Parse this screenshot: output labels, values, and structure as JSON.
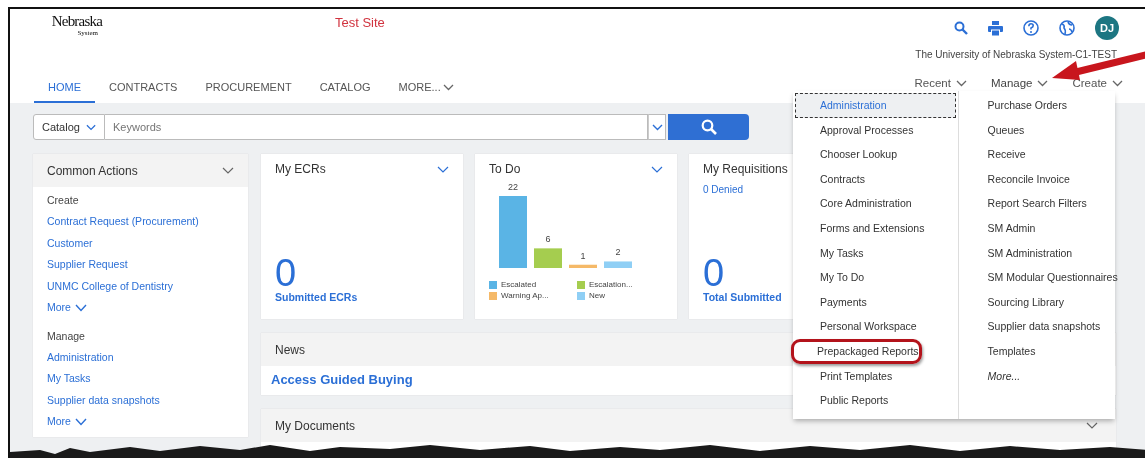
{
  "header": {
    "logo": {
      "top": "Nebraska",
      "sub": "System"
    },
    "site_label": "Test Site",
    "avatar": "DJ",
    "organization": "The University of Nebraska System-C1-TEST"
  },
  "tabs": [
    {
      "label": "HOME",
      "selected": true
    },
    {
      "label": "CONTRACTS",
      "selected": false
    },
    {
      "label": "PROCUREMENT",
      "selected": false
    },
    {
      "label": "CATALOG",
      "selected": false
    },
    {
      "label": "MORE...",
      "selected": false
    }
  ],
  "quick_menus": [
    {
      "label": "Recent",
      "expanded": false
    },
    {
      "label": "Manage",
      "expanded": true
    },
    {
      "label": "Create",
      "expanded": false
    }
  ],
  "search": {
    "scope": "Catalog",
    "placeholder": "Keywords"
  },
  "common_actions": {
    "title": "Common Actions",
    "sections": [
      {
        "heading": "Create",
        "links": [
          "Contract Request (Procurement)",
          "Customer",
          "Supplier Request",
          "UNMC College of Dentistry"
        ],
        "more": "More"
      },
      {
        "heading": "Manage",
        "links": [
          "Administration",
          "My Tasks",
          "Supplier data snapshots"
        ],
        "more": "More"
      }
    ]
  },
  "ecrs": {
    "title": "My ECRs",
    "count": "0",
    "caption": "Submitted ECRs"
  },
  "todo": {
    "title": "To Do",
    "bar_labels": [
      "22",
      "6",
      "1",
      "2"
    ],
    "legend": [
      {
        "label": "Escalated",
        "color": "#5ab4e5"
      },
      {
        "label": "Escalation...",
        "color": "#a5cd4f"
      },
      {
        "label": "Warning Ap...",
        "color": "#f5b968"
      },
      {
        "label": "New",
        "color": "#8fcff5"
      }
    ]
  },
  "requisitions": {
    "title": "My Requisitions",
    "denied": "0 Denied",
    "count": "0",
    "caption": "Total Submitted"
  },
  "news": {
    "title": "News",
    "link": "Access Guided Buying"
  },
  "documents": {
    "title": "My Documents"
  },
  "manage_menu": {
    "columns": [
      [
        {
          "label": "Administration",
          "selected": true,
          "highlighted": false
        },
        {
          "label": "Approval Processes",
          "selected": false,
          "highlighted": false
        },
        {
          "label": "Chooser Lookup",
          "selected": false,
          "highlighted": false
        },
        {
          "label": "Contracts",
          "selected": false,
          "highlighted": false
        },
        {
          "label": "Core Administration",
          "selected": false,
          "highlighted": false
        },
        {
          "label": "Forms and Extensions",
          "selected": false,
          "highlighted": false
        },
        {
          "label": "My Tasks",
          "selected": false,
          "highlighted": false
        },
        {
          "label": "My To Do",
          "selected": false,
          "highlighted": false
        },
        {
          "label": "Payments",
          "selected": false,
          "highlighted": false
        },
        {
          "label": "Personal Workspace",
          "selected": false,
          "highlighted": false
        },
        {
          "label": "Prepackaged Reports",
          "selected": false,
          "highlighted": true
        },
        {
          "label": "Print Templates",
          "selected": false,
          "highlighted": false
        },
        {
          "label": "Public Reports",
          "selected": false,
          "highlighted": false
        }
      ],
      [
        {
          "label": "Purchase Orders",
          "selected": false,
          "highlighted": false
        },
        {
          "label": "Queues",
          "selected": false,
          "highlighted": false
        },
        {
          "label": "Receive",
          "selected": false,
          "highlighted": false
        },
        {
          "label": "Reconcile Invoice",
          "selected": false,
          "highlighted": false
        },
        {
          "label": "Report Search Filters",
          "selected": false,
          "highlighted": false
        },
        {
          "label": "SM Admin",
          "selected": false,
          "highlighted": false
        },
        {
          "label": "SM Administration",
          "selected": false,
          "highlighted": false
        },
        {
          "label": "SM Modular Questionnaires",
          "selected": false,
          "highlighted": false
        },
        {
          "label": "Sourcing Library",
          "selected": false,
          "highlighted": false
        },
        {
          "label": "Supplier data snapshots",
          "selected": false,
          "highlighted": false
        },
        {
          "label": "Templates",
          "selected": false,
          "highlighted": false
        },
        {
          "label": "More...",
          "selected": false,
          "highlighted": false,
          "kind": "more"
        }
      ]
    ]
  }
}
